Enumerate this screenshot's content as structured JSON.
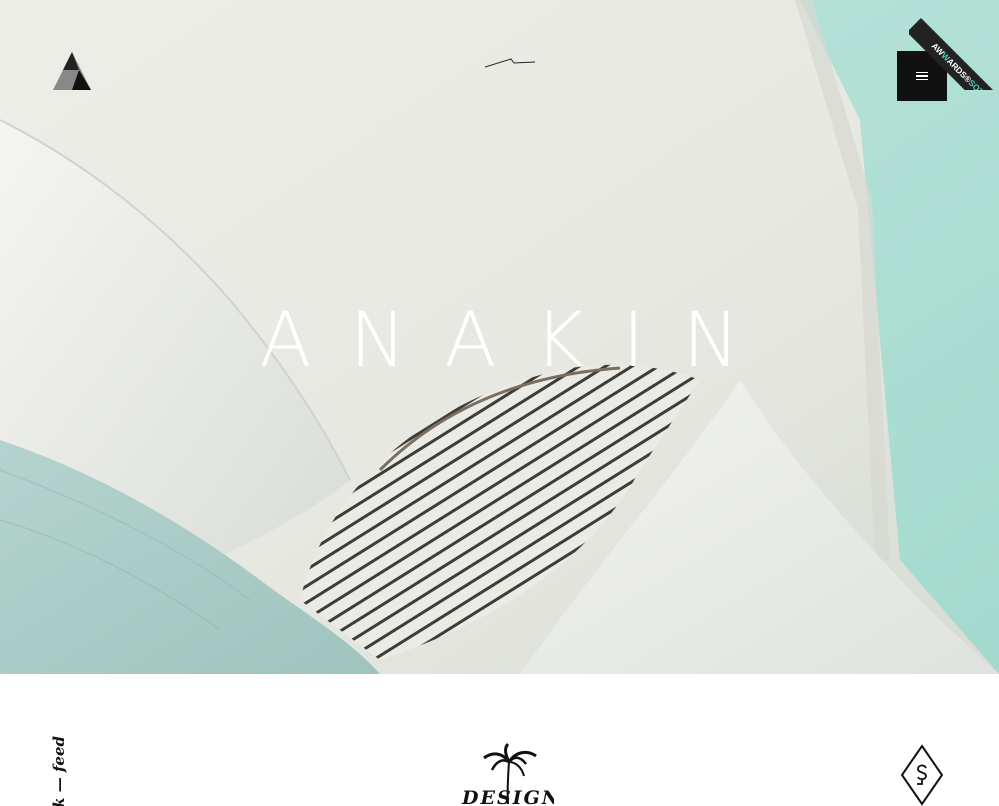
{
  "app": {
    "title": "ANAKIN"
  },
  "hero": {
    "title": "ANAKIN"
  },
  "header": {
    "logo_icon": "triangle-logo-icon",
    "center_icon": "signature-line-icon",
    "menu_icon": "hamburger-menu-icon"
  },
  "ribbon": {
    "part1": "AW",
    "part2": "W",
    "part3": "ARDS",
    "part4": "®",
    "part5": "SOTD"
  },
  "bottom": {
    "vertical_text": "work — feed",
    "center_logo_text": "DESIGN",
    "center_logo_icon": "palm-tree-icon",
    "right_logo_icon": "diamond-monogram-icon"
  },
  "colors": {
    "accent": "#4ecfc0",
    "sky": "#a9dccf",
    "menu_bg": "#111111",
    "title": "#ffffff"
  }
}
